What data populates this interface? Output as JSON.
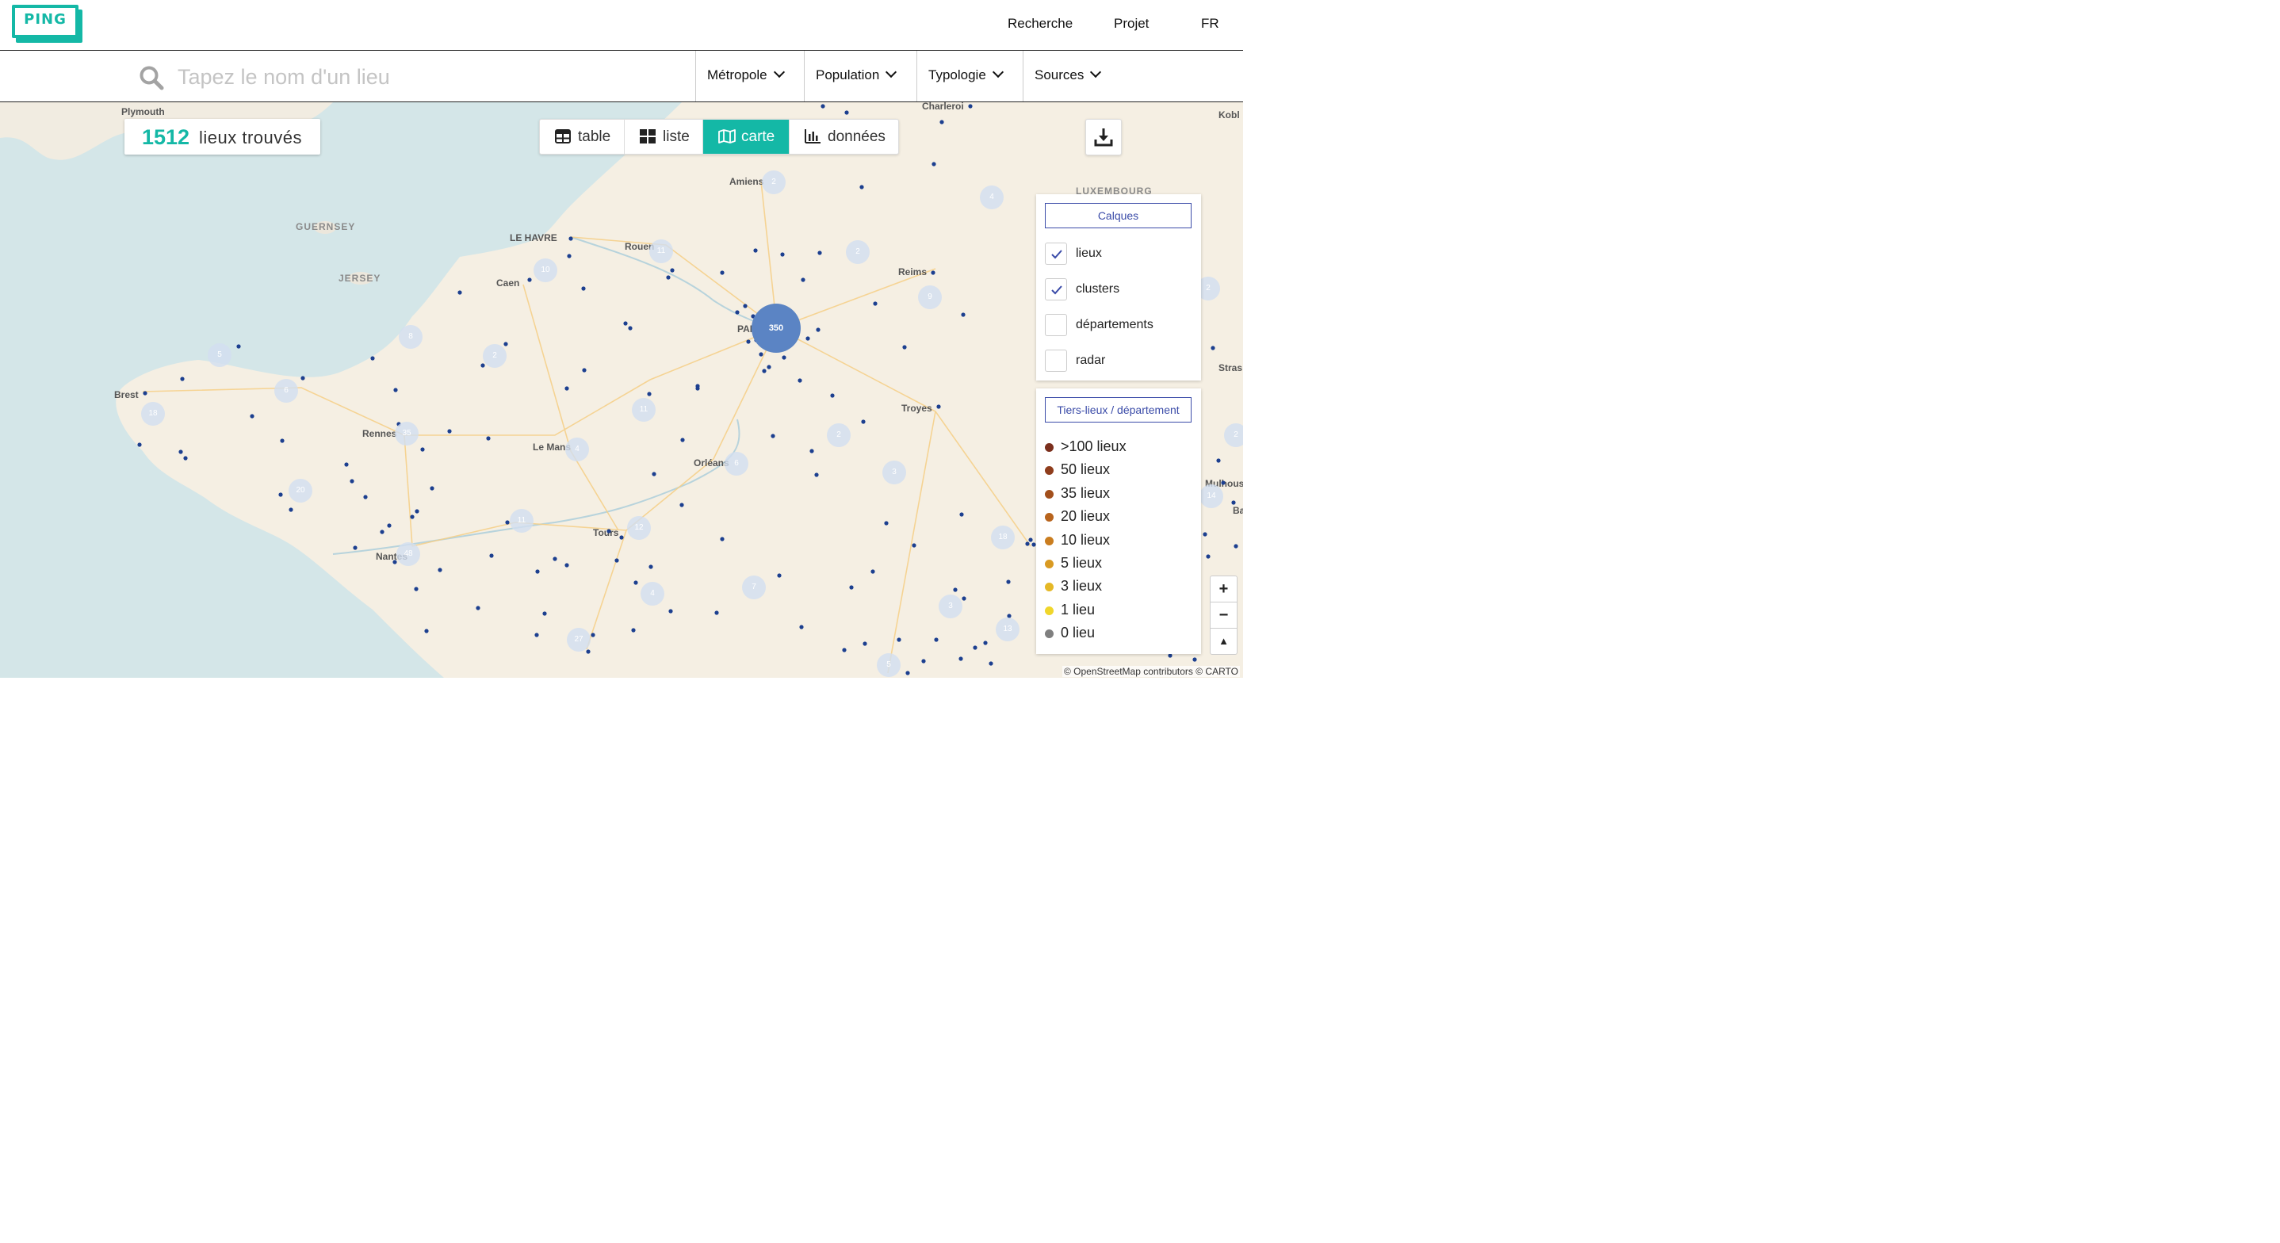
{
  "header": {
    "logo_text": "PING",
    "nav": [
      {
        "label": "Recherche"
      },
      {
        "label": "Projet"
      },
      {
        "label": "FR"
      }
    ]
  },
  "search": {
    "placeholder": "Tapez le nom d'un lieu",
    "filters": [
      {
        "label": "Métropole"
      },
      {
        "label": "Population"
      },
      {
        "label": "Typologie"
      },
      {
        "label": "Sources"
      }
    ]
  },
  "results": {
    "count": "1512",
    "label": "lieux trouvés"
  },
  "view_tabs": [
    {
      "label": "table",
      "icon": "table-icon",
      "active": false
    },
    {
      "label": "liste",
      "icon": "grid-icon",
      "active": false
    },
    {
      "label": "carte",
      "icon": "map-icon",
      "active": true
    },
    {
      "label": "données",
      "icon": "bar-chart-icon",
      "active": false
    }
  ],
  "layers": {
    "button": "Calques",
    "items": [
      {
        "label": "lieux",
        "checked": true
      },
      {
        "label": "clusters",
        "checked": true
      },
      {
        "label": "départements",
        "checked": false
      },
      {
        "label": "radar",
        "checked": false
      }
    ]
  },
  "legend": {
    "button": "Tiers-lieux / département",
    "items": [
      {
        "label": ">100 lieux",
        "color": "#7b2f1d"
      },
      {
        "label": "50 lieux",
        "color": "#8f3d1c"
      },
      {
        "label": "35 lieux",
        "color": "#a24f1c"
      },
      {
        "label": "20 lieux",
        "color": "#b8641d"
      },
      {
        "label": "10 lieux",
        "color": "#ca7d1f"
      },
      {
        "label": "5 lieux",
        "color": "#d99a22"
      },
      {
        "label": "3 lieux",
        "color": "#e5b826"
      },
      {
        "label": "1 lieu",
        "color": "#f0d62b"
      },
      {
        "label": "0 lieu",
        "color": "#7f7f7f"
      }
    ]
  },
  "zoom": {
    "in": "+",
    "out": "−",
    "reset": "▲"
  },
  "attribution": "© OpenStreetMap contributors © CARTO",
  "map": {
    "place_labels": [
      "Plymouth",
      "GUERNSEY",
      "JERSEY",
      "LE HAVRE",
      "Caen",
      "Rouen",
      "Amiens",
      "Charleroi",
      "LUXEMBOURG",
      "Reims",
      "PARIS",
      "Brest",
      "Rennes",
      "Le Mans",
      "Orléans",
      "Troyes",
      "Tours",
      "Nantes",
      "Kobl",
      "Stras",
      "Mulhouse",
      "Ba"
    ],
    "clusters": [
      "350",
      "2",
      "4",
      "11",
      "2",
      "10",
      "8",
      "9",
      "2",
      "5",
      "6",
      "18",
      "35",
      "11",
      "4",
      "6",
      "2",
      "3",
      "20",
      "11",
      "12",
      "48",
      "18",
      "14",
      "4",
      "7",
      "3",
      "27",
      "13",
      "5",
      "2",
      "2"
    ]
  }
}
